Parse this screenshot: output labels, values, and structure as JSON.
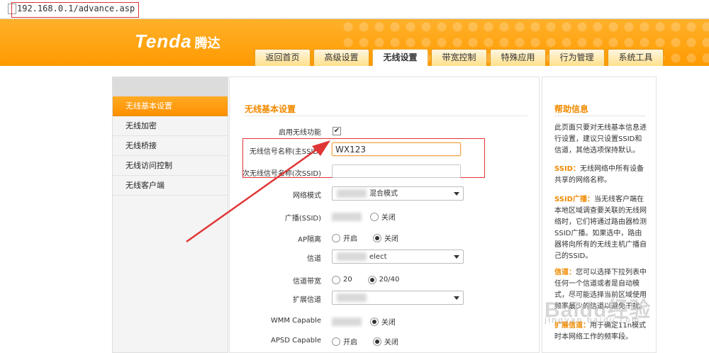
{
  "address_bar": {
    "url": "192.168.0.1/advance.asp"
  },
  "header": {
    "logo_text": "Tenda",
    "logo_cn": "腾达",
    "brand_color": "#ff9a00"
  },
  "tabs": [
    {
      "label": "返回首页",
      "active": false
    },
    {
      "label": "高级设置",
      "active": false
    },
    {
      "label": "无线设置",
      "active": true
    },
    {
      "label": "带宽控制",
      "active": false
    },
    {
      "label": "特殊应用",
      "active": false
    },
    {
      "label": "行为管理",
      "active": false
    },
    {
      "label": "系统工具",
      "active": false
    }
  ],
  "sidebar": {
    "items": [
      {
        "label": "无线基本设置",
        "active": true
      },
      {
        "label": "无线加密",
        "active": false
      },
      {
        "label": "无线桥接",
        "active": false
      },
      {
        "label": "无线访问控制",
        "active": false
      },
      {
        "label": "无线客户端",
        "active": false
      }
    ]
  },
  "main": {
    "title": "无线基本设置",
    "enable_label": "启用无线功能",
    "enable_checked": true,
    "ssid_label": "无线信号名称(主SSID)",
    "ssid_value": "WX123",
    "ssid2_label": "次无线信号名称(次SSID)",
    "ssid2_value": "",
    "network_mode_label": "网络模式",
    "network_mode_value": "混合模式",
    "broadcast_label": "广播(SSID)",
    "ap_isolation_label": "AP隔离",
    "channel_label": "信道",
    "channel_value": "elect",
    "bandwidth_label": "信道带宽",
    "ext_channel_label": "扩展信道",
    "wmm_label": "WMM Capable",
    "apsd_label": "APSD Capable",
    "opt_on": "开启",
    "opt_off": "关闭",
    "bw_20": "20",
    "bw_2040": "20/40"
  },
  "help": {
    "title": "帮助信息",
    "p1": "此页面只要对无线基本信息进行设置，建议只设置SSID和信道，其他选项保持默认。",
    "p2_key": "SSID：",
    "p2": "无线网络中所有设备共享的网络名称。",
    "p3_key": "SSID广播：",
    "p3": "当无线客户端在本地区域调查要关联的无线网络时，它们将通过路由器检测SSID广播。如果选中，路由器将向所有的无线主机广播自己的SSID。",
    "p4_key": "信道：",
    "p4": "您可以选择下拉列表中任何一个信道或者是自动模式，尽可能选择当前区域使用频率最少的信道以避免干扰。",
    "p5_key": "扩展信道：",
    "p5": "用于确定11n模式时本网络工作的频率段。"
  },
  "watermark": {
    "text": "Baidu经验",
    "sub": "jingyan.baidu.com"
  }
}
